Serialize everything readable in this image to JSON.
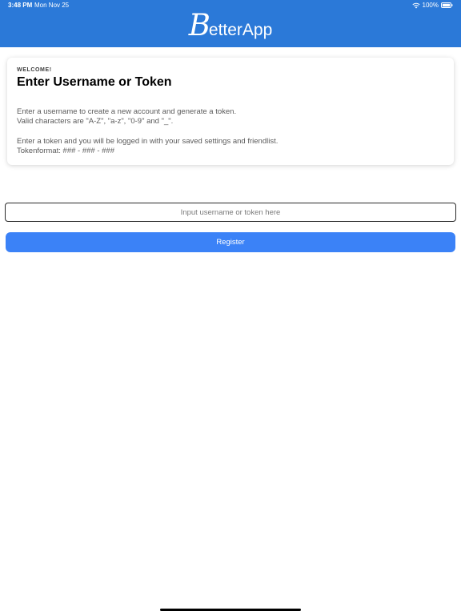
{
  "status_bar": {
    "time": "3:48 PM",
    "date": "Mon Nov 25",
    "battery": "100%",
    "icons": [
      "wifi-icon",
      "battery-icon"
    ]
  },
  "header": {
    "logo_initial": "B",
    "logo_rest": "etterApp",
    "background": "#2b79d8"
  },
  "card": {
    "kicker": "WELCOME!",
    "title": "Enter Username or Token",
    "lines": [
      "Enter a username to create a new account and generate a token.",
      "Valid characters are \"A-Z\", \"a-z\", \"0-9\" and \"_\".",
      "Enter a token and you will be logged in with your saved settings and friendlist.",
      "Tokenformat: ### - ### - ###"
    ]
  },
  "form": {
    "input_value": "",
    "input_placeholder": "Input username or token here",
    "register_label": "Register",
    "accent": "#3b82f7"
  }
}
